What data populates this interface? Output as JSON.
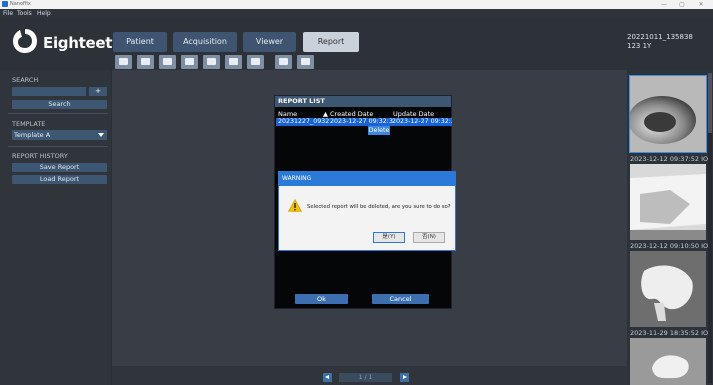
{
  "window": {
    "title": "Nanoffix",
    "minimize": "—",
    "maximize": "▢",
    "close": "✕"
  },
  "menu": [
    "File",
    "Tools",
    "Help"
  ],
  "brand": {
    "name": "Eighteeth"
  },
  "nav_tabs": [
    {
      "label": "Patient",
      "active": false
    },
    {
      "label": "Acquisition",
      "active": false
    },
    {
      "label": "Viewer",
      "active": false
    },
    {
      "label": "Report",
      "active": true
    }
  ],
  "toolbar_icons": [
    "report-print-icon",
    "report-copy-icon",
    "report-paste-icon",
    "report-page-icon",
    "report-layout-icon",
    "report-add-icon",
    "report-remove-icon",
    "report-single-view-icon",
    "report-split-view-icon"
  ],
  "patient": {
    "id": "20221011_135838",
    "details": "123  1Y"
  },
  "sidebar": {
    "search_heading": "SEARCH",
    "search_placeholder": "",
    "search_plus": "+",
    "search_button": "Search",
    "template_heading": "TEMPLATE",
    "template_value": "Template A",
    "history_heading": "REPORT HISTORY",
    "save_report": "Save Report",
    "load_report": "Load Report"
  },
  "report_list": {
    "title": "REPORT LIST",
    "columns": {
      "name": "Name",
      "created": "Created Date",
      "updated": "Update Date"
    },
    "rows": [
      {
        "name": "20231227_0932",
        "created": "2023-12-27 09:32:3",
        "updated": "2023-12-27 09:32:3"
      }
    ],
    "context_delete": "Delete",
    "ok": "Ok",
    "cancel": "Cancel"
  },
  "warning": {
    "title": "WARNING",
    "message": "Selected report will be deleted, are you sure to do so?",
    "yes": "是(Y)",
    "no": "否(N)"
  },
  "pager": {
    "value": "1 / 1"
  },
  "thumbnails": [
    {
      "label": "2023-12-12 09:37:52  IO",
      "selected": true
    },
    {
      "label": "2023-12-12 09:10:50  IO",
      "selected": false
    },
    {
      "label": "2023-11-29 18:35:52  IO",
      "selected": false
    },
    {
      "label": "",
      "selected": false
    }
  ],
  "colors": {
    "accent": "#2b79d8",
    "nav_dark": "#3e5470",
    "nav_active": "#c9d1da",
    "selection": "#1864d6",
    "warning_icon": "#f2c200"
  }
}
